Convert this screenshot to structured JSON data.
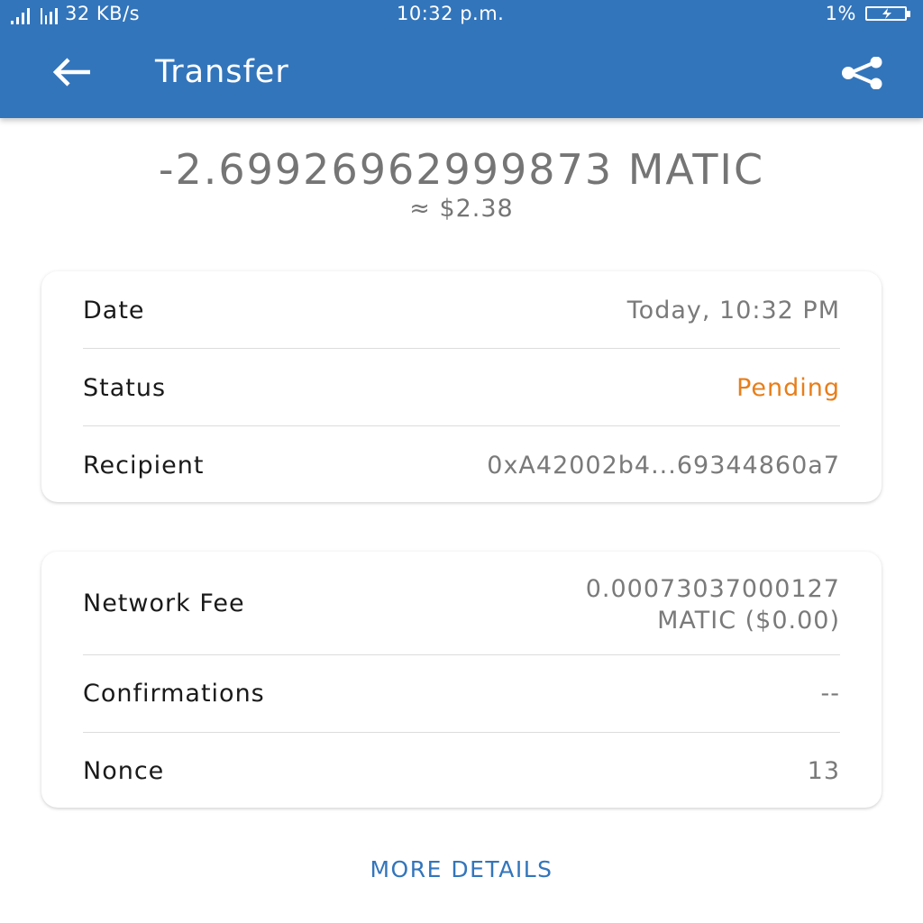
{
  "status_bar": {
    "network_speed": "32 KB/s",
    "time": "10:32 p.m.",
    "battery_percent": "1%",
    "battery_level": 0.01
  },
  "header": {
    "title": "Transfer",
    "back_icon": "arrow-left-icon",
    "share_icon": "share-icon",
    "color": "#3375bb"
  },
  "amount": {
    "value": "-2.69926962999873 MATIC",
    "fiat": "≈ $2.38"
  },
  "details": [
    {
      "label": "Date",
      "value": "Today, 10:32 PM"
    },
    {
      "label": "Status",
      "value": "Pending",
      "color": "#e87e1a"
    },
    {
      "label": "Recipient",
      "value": "0xA42002b4...69344860a7"
    }
  ],
  "network": {
    "fee_label": "Network Fee",
    "fee_value_line1": "0.00073037000127",
    "fee_value_line2": "MATIC ($0.00)",
    "confirmations_label": "Confirmations",
    "confirmations_value": "--",
    "nonce_label": "Nonce",
    "nonce_value": "13"
  },
  "more_details": "MORE DETAILS"
}
